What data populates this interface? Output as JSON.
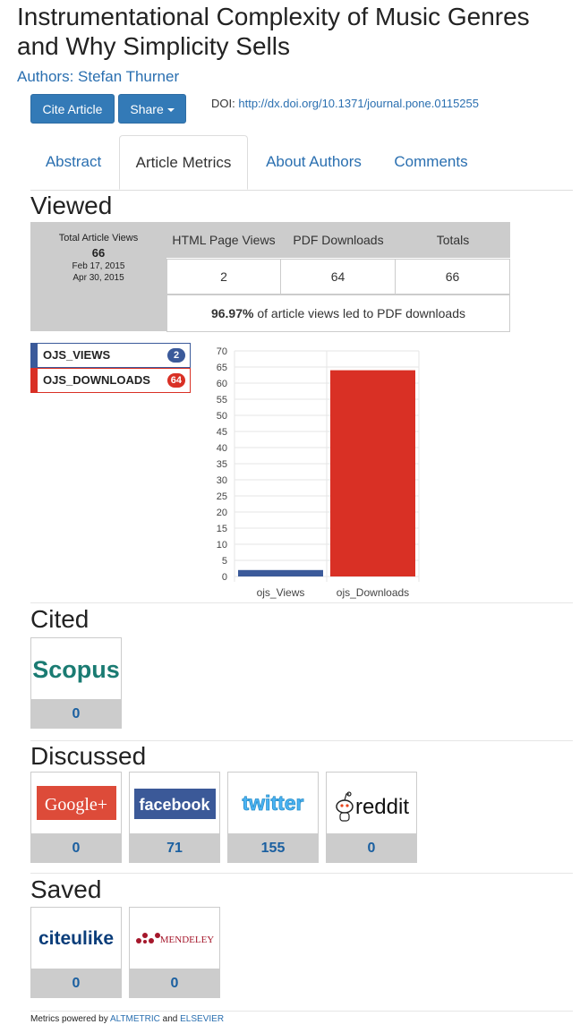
{
  "article": {
    "title": "Instrumentational Complexity of Music Genres and Why Simplicity Sells",
    "authors": "Authors: Stefan Thurner",
    "doi_label": "DOI:",
    "doi_link": "http://dx.doi.org/10.1371/journal.pone.0115255"
  },
  "buttons": {
    "cite": "Cite Article",
    "share": "Share"
  },
  "tabs": [
    "Abstract",
    "Article Metrics",
    "About Authors",
    "Comments"
  ],
  "viewed": {
    "heading": "Viewed",
    "total_label": "Total Article Views",
    "total_value": "66",
    "date_from": "Feb 17, 2015",
    "date_to": "Apr 30, 2015",
    "headers": [
      "HTML Page Views",
      "PDF Downloads",
      "Totals"
    ],
    "values": [
      "2",
      "64",
      "66"
    ],
    "pct": "96.97%",
    "pct_text": " of article views led to PDF downloads"
  },
  "legend": [
    {
      "label": "OJS_VIEWS",
      "count": "2",
      "color": "#3b5a9a"
    },
    {
      "label": "OJS_DOWNLOADS",
      "count": "64",
      "color": "#d93025"
    }
  ],
  "chart_data": {
    "type": "bar",
    "categories": [
      "ojs_Views",
      "ojs_Downloads"
    ],
    "values": [
      2,
      64
    ],
    "colors": [
      "#3b5a9a",
      "#d93025"
    ],
    "ylim": [
      0,
      70
    ],
    "yticks": [
      0,
      5,
      10,
      15,
      20,
      25,
      30,
      35,
      40,
      45,
      50,
      55,
      60,
      65,
      70
    ],
    "grid": true
  },
  "cited": {
    "heading": "Cited",
    "items": [
      {
        "name": "Scopus",
        "count": "0"
      }
    ]
  },
  "discussed": {
    "heading": "Discussed",
    "items": [
      {
        "name": "Google+",
        "count": "0"
      },
      {
        "name": "facebook",
        "count": "71"
      },
      {
        "name": "twitter",
        "count": "155"
      },
      {
        "name": "reddit",
        "count": "0"
      }
    ]
  },
  "saved": {
    "heading": "Saved",
    "items": [
      {
        "name": "citeulike",
        "count": "0"
      },
      {
        "name": "MENDELEY",
        "count": "0"
      }
    ]
  },
  "footer": {
    "prefix": "Metrics powered by ",
    "link1": "ALTMETRIC",
    "mid": " and ",
    "link2": "ELSEVIER"
  }
}
